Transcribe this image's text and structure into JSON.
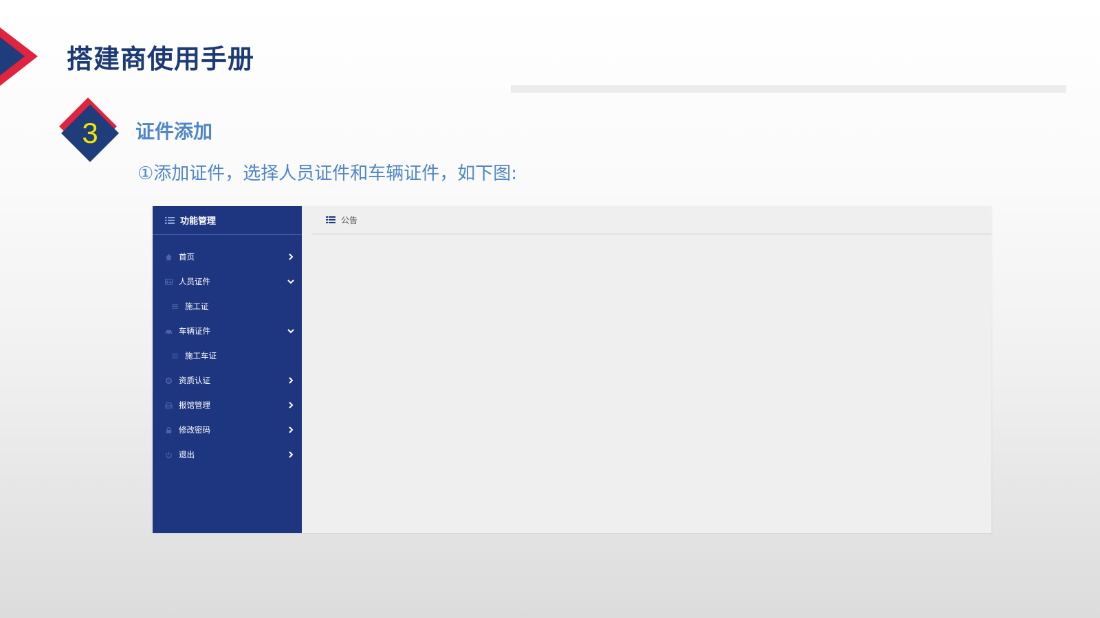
{
  "slide": {
    "title": "搭建商使用手册",
    "step_number": "3",
    "section_title": "证件添加",
    "instruction": "①添加证件，选择人员证件和车辆证件，如下图:"
  },
  "colors": {
    "title": "#1c3a75",
    "accent_red": "#e0233f",
    "accent_navy": "#1f3d7a",
    "step_number": "#f2e500",
    "section_text": "#4f86c6",
    "sidebar_bg": "#1e3680",
    "content_bg": "#efefef"
  },
  "app": {
    "sidebar": {
      "header": "功能管理",
      "header_icon": "list-icon",
      "items": [
        {
          "label": "首页",
          "icon": "home-icon",
          "state": "collapsed"
        },
        {
          "label": "人员证件",
          "icon": "id-card-icon",
          "state": "expanded"
        },
        {
          "label": "施工证",
          "icon": "list-icon",
          "sub": true
        },
        {
          "label": "车辆证件",
          "icon": "car-icon",
          "state": "expanded"
        },
        {
          "label": "施工车证",
          "icon": "list-icon",
          "sub": true
        },
        {
          "label": "资质认证",
          "icon": "gear-icon",
          "state": "collapsed"
        },
        {
          "label": "报馆管理",
          "icon": "inbox-icon",
          "state": "collapsed"
        },
        {
          "label": "修改密码",
          "icon": "lock-icon",
          "state": "collapsed"
        },
        {
          "label": "退出",
          "icon": "power-icon",
          "state": "collapsed"
        }
      ]
    },
    "tab": {
      "label": "公告",
      "icon": "list-icon"
    }
  }
}
